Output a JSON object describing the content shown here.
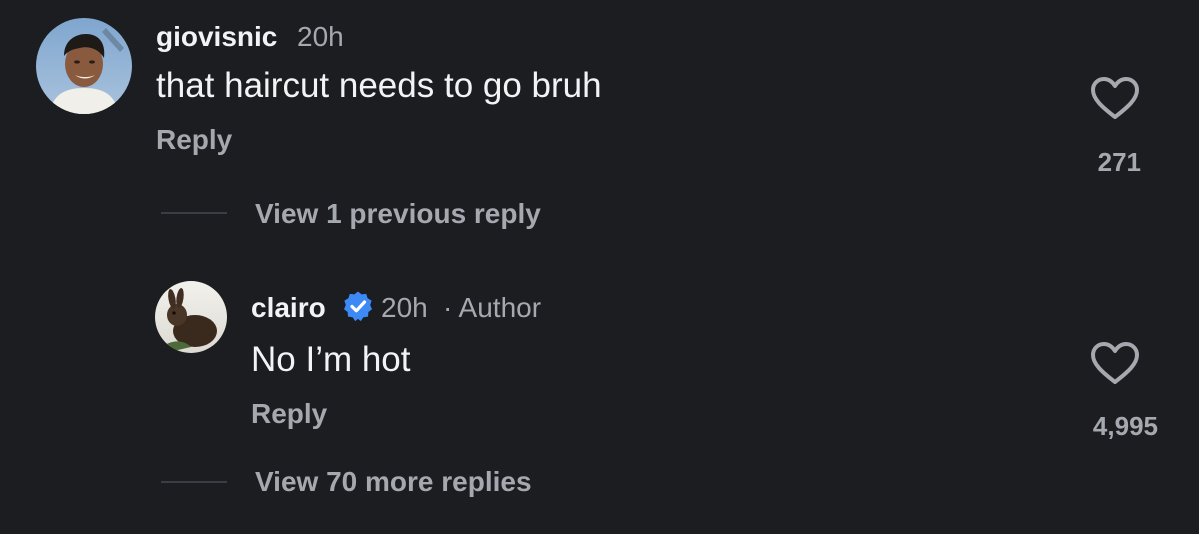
{
  "comments": [
    {
      "username": "giovisnic",
      "time": "20h",
      "text": "that haircut needs to go bruh",
      "reply_label": "Reply",
      "likes": "271"
    },
    {
      "username": "clairo",
      "time": "20h",
      "author_tag": "· Author",
      "verified": true,
      "text": "No I’m hot",
      "reply_label": "Reply",
      "likes": "4,995"
    }
  ],
  "view_previous_label": "View 1 previous reply",
  "view_more_label": "View 70 more replies",
  "colors": {
    "background": "#1b1d21",
    "primary_text": "#f2f3f5",
    "secondary_text": "#a5a8ae",
    "verified_badge": "#3d8af7"
  },
  "icons": [
    "heart-outline-icon",
    "verified-badge-icon"
  ]
}
